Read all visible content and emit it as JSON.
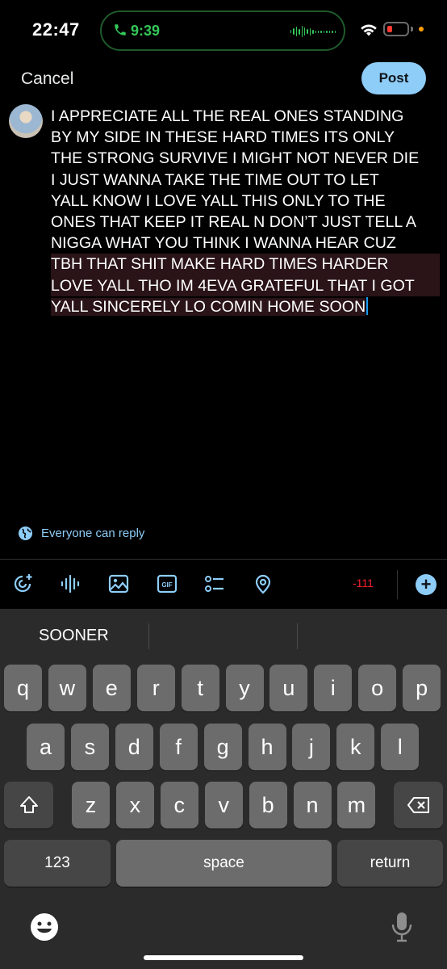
{
  "status_bar": {
    "time": "22:47",
    "call_time": "9:39"
  },
  "compose": {
    "cancel_label": "Cancel",
    "post_label": "Post",
    "tweet_lines": [
      "I APPRECIATE ALL THE REAL ONES STANDING",
      "BY MY SIDE IN THESE HARD TIMES ITS ONLY",
      "THE STRONG SURVIVE I MIGHT NOT NEVER DIE",
      "I JUST WANNA TAKE THE TIME OUT TO LET",
      "YALL KNOW I LOVE YALL THIS ONLY TO THE",
      "ONES THAT KEEP IT REAL N DON’T JUST TELL A",
      "NIGGA WHAT YOU THINK I WANNA HEAR CUZ",
      "TBH THAT SHIT MAKE HARD TIMES HARDER",
      "LOVE YALL THO IM 4EVA GRATEFUL THAT I GOT",
      "YALL SINCERELY LO COMIN HOME SOON"
    ],
    "reply_setting": "Everyone can reply",
    "char_count": "-111"
  },
  "toolbar_icons": [
    "voice-compose-icon",
    "audio-wave-icon",
    "image-icon",
    "gif-icon",
    "poll-icon",
    "location-icon",
    "add-thread-icon"
  ],
  "keyboard": {
    "suggestion": "SOONER",
    "row1": [
      "q",
      "w",
      "e",
      "r",
      "t",
      "y",
      "u",
      "i",
      "o",
      "p"
    ],
    "row2": [
      "a",
      "s",
      "d",
      "f",
      "g",
      "h",
      "j",
      "k",
      "l"
    ],
    "row3": [
      "z",
      "x",
      "c",
      "v",
      "b",
      "n",
      "m"
    ],
    "numbers_label": "123",
    "space_label": "space",
    "return_label": "return"
  },
  "colors": {
    "accent": "#8ecdf8",
    "call_green": "#34c759",
    "over_limit_red": "#f4212e",
    "overflow_highlight": "#2a1418",
    "keyboard_bg": "#2b2b2b",
    "key_bg": "#6c6c6c",
    "key_dark_bg": "#464646"
  }
}
